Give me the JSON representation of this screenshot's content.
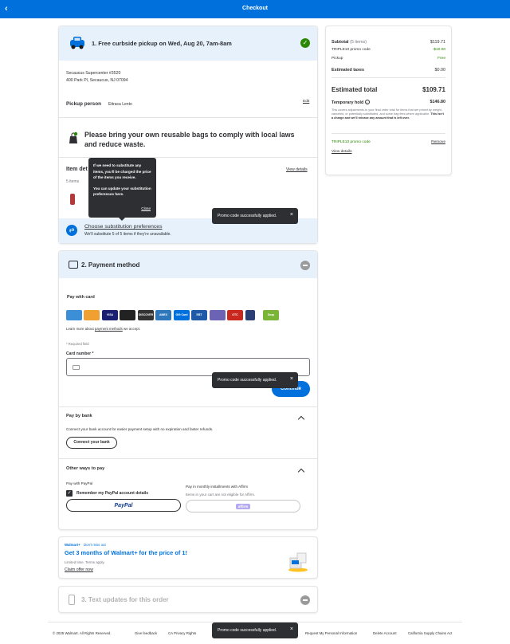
{
  "header": {
    "title": "Checkout",
    "back_icon": "chevron-left-icon"
  },
  "pickup": {
    "title": "1. Free curbside pickup on Wed, Aug 20, 7am-8am",
    "store_name": "Secaucus Supercenter #3520",
    "store_address": "400 Park Pl, Secaucus, NJ 07094",
    "pickup_person_label": "Pickup person",
    "pickup_person_name": "Ettraca Lento",
    "edit_label": "Edit",
    "bags_notice": "Please bring your own reusable bags to comply with local laws and reduce waste.",
    "item_details_label": "Item det",
    "items_count": "5 items",
    "view_details": "View details",
    "substitution_link": "Choose substitution preferences",
    "substitution_sub": "We'll substitute 5 of 5 items if they're unavailable."
  },
  "tooltip": {
    "line1": "If we need to substitute any items, you'll be charged the price of the items you receive.",
    "line2": "You can update your substitution preferences here.",
    "close": "Close"
  },
  "toast": {
    "message": "Promo code successfully applied.",
    "close": "×"
  },
  "payment": {
    "title": "2. Payment method",
    "pay_with_card": "Pay with card",
    "methods": [
      "",
      "",
      "VISA",
      "",
      "DISCOVER",
      "AMEX",
      "Gift Card",
      "EBT",
      "",
      "OTC",
      "",
      "Snap"
    ],
    "learn_more": "Learn more about",
    "learn_more_link": "payment methods",
    "learn_more_suffix": "we accept.",
    "required_note": "* Required field",
    "card_number_label": "Card number *",
    "continue_label": "Continue",
    "pay_by_bank": "Pay by bank",
    "pay_by_bank_desc": "Connect your bank account for easier payment setup with no expiration and faster refunds.",
    "connect_bank": "Connect your bank",
    "other_ways": "Other ways to pay",
    "pay_with_paypal": "Pay with PayPal",
    "remember_paypal": "Remember my PayPal account details",
    "paypal_logo": "PayPal",
    "affirm_title": "Pay in monthly installments with Affirm",
    "affirm_desc": "Items in your cart are not eligible for Affirm.",
    "affirm_logo": "affirm"
  },
  "walmart_plus": {
    "brand": "Walmart+",
    "tag": "Don't miss out",
    "headline": "Get 3 months of Walmart+ for the price of 1!",
    "terms": "Limited time. Terms apply.",
    "cta": "Claim offer now"
  },
  "text_updates": {
    "title": "3. Text updates for this order"
  },
  "summary": {
    "subtotal_label": "Subtotal",
    "subtotal_items": "(5 items)",
    "subtotal_value": "$119.71",
    "promo_label": "TRIPLE10 promo code",
    "promo_value": "-$10.00",
    "pickup_label": "Pickup",
    "pickup_value": "Free",
    "taxes_label": "Estimated taxes",
    "taxes_value": "$0.00",
    "total_label": "Estimated total",
    "total_value": "$109.71",
    "hold_label": "Temporary hold",
    "hold_value": "$146.80",
    "hold_desc": "This covers adjustments to your final order total for items that are priced by weight, canceled, or potentially substituted, and some bag fees where applicable.",
    "hold_desc_bold": "This isn't a charge and we'll release any amount that is left over.",
    "promo_applied": "TRIPLE10 promo code",
    "remove": "Remove",
    "view_details": "View details"
  },
  "footer": {
    "copyright": "© 2025 Walmart. All Rights Reserved.",
    "links": [
      "Give feedback",
      "CA Privacy Rights",
      "Request My Personal Information",
      "Delete Account",
      "California Supply Chains Act"
    ]
  },
  "colors": {
    "brand_blue": "#0071dc",
    "promo_green": "#2a8703",
    "walmart_yellow": "#ffc220"
  }
}
